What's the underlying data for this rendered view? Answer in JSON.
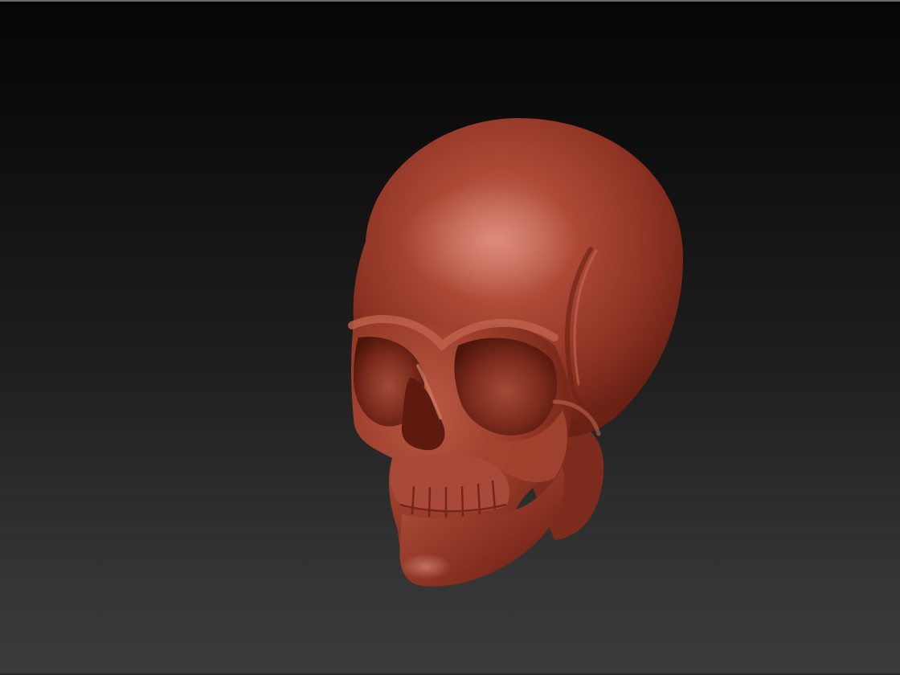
{
  "canvas": {
    "background_top": "#050505",
    "background_bottom": "#3b3b3b"
  },
  "model": {
    "name": "skull-model",
    "material_color": "#a8402e",
    "highlight_color": "#d4806c",
    "shadow_color": "#5a1a10"
  }
}
